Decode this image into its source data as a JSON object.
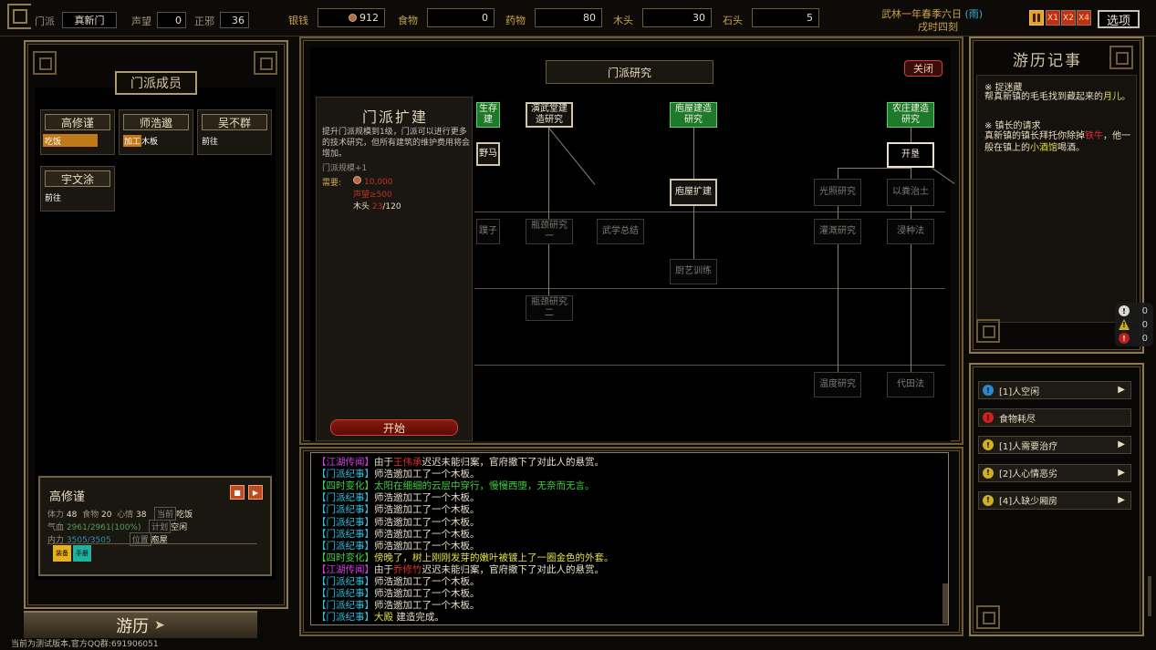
{
  "topbar": {
    "sect_label": "门派",
    "sect_name": "真新门",
    "reputation_label": "声望",
    "reputation": "0",
    "righteous_label": "正邪",
    "righteous": "36",
    "resources": [
      {
        "label": "银钱",
        "value": "912",
        "icon": "coin-icon"
      },
      {
        "label": "食物",
        "value": "0"
      },
      {
        "label": "药物",
        "value": "80"
      },
      {
        "label": "木头",
        "value": "30"
      },
      {
        "label": "石头",
        "value": "5"
      }
    ],
    "date": "武林一年春季六日",
    "weather": "(雨)",
    "time": "戌时四刻",
    "speeds": [
      "X1",
      "X2",
      "X4"
    ],
    "options_label": "选项"
  },
  "members": {
    "title": "门派成员",
    "list": [
      {
        "name": "高修谨",
        "action": "吃饭"
      },
      {
        "name": "师浩邈",
        "action_tag": "加工",
        "action": "木板"
      },
      {
        "name": "吴不群",
        "action": "前往"
      },
      {
        "name": "宇文涂",
        "action": "前往"
      }
    ]
  },
  "status": {
    "name": "高修谨",
    "stamina_label": "体力",
    "stamina": "48",
    "food_label": "食物",
    "food": "20",
    "mood_label": "心情",
    "mood": "38",
    "current_tag": "当前",
    "current": "吃饭",
    "qi_label": "气血",
    "qi": "2961/2961(100%)",
    "plan_tag": "计划",
    "plan": "空闲",
    "inner_label": "内力",
    "inner": "3505/3505",
    "pos_tag": "位置",
    "pos": "庖屋",
    "btn1": "装备",
    "btn2": "手册"
  },
  "travel_label": "游历",
  "research": {
    "title": "门派研究",
    "close_label": "关闭",
    "detail": {
      "name": "门派扩建",
      "desc": "提升门派规模到1级，门派可以进行更多的技术研究，但所有建筑的维护费用将会增加。",
      "effect": "门派规模+1",
      "need_label": "需要:",
      "need_money": "10,000",
      "need_rep": "声望≥500",
      "need_wood_label": "木头",
      "need_wood_have": "23",
      "need_wood_total": "/120"
    },
    "start_label": "开始",
    "nodes": {
      "survive": "生存\n建",
      "wild_horse": "野马",
      "dojo": "演武堂建\n造研究",
      "kitchen_build": "庖屋建造\n研究",
      "farm_build": "农庄建造\n研究",
      "cultivate": "开垦",
      "kitchen_expand": "庖屋扩建",
      "light": "光照研究",
      "manure": "以粪治土",
      "neck1": "瓶颈研究\n一",
      "martial": "武学总结",
      "ziza": "蹼子",
      "irrigate": "灌溉研究",
      "seed": "浸种法",
      "cook": "厨艺训练",
      "neck2": "瓶颈研究\n二",
      "temp": "温度研究",
      "field": "代田法"
    }
  },
  "log": [
    {
      "tag": "【江湖传闻】",
      "tag_color": "#d040e0",
      "parts": [
        {
          "t": "由于",
          "c": "#e8e0cc"
        },
        {
          "t": "王伟承",
          "c": "#e03030"
        },
        {
          "t": "迟迟未能归案，官府撤下了对此人的悬赏。",
          "c": "#e8e0cc"
        }
      ]
    },
    {
      "tag": "【门派纪事】",
      "tag_color": "#30c0e0",
      "parts": [
        {
          "t": "师浩邈加工了一个木板。",
          "c": "#e8e0cc"
        }
      ]
    },
    {
      "tag": "【四时变化】",
      "tag_color": "#40d040",
      "parts": [
        {
          "t": "太阳在细细的云层中穿行，慢慢西堕，无奈而无言。",
          "c": "#40d040"
        }
      ]
    },
    {
      "tag": "【门派纪事】",
      "tag_color": "#30c0e0",
      "parts": [
        {
          "t": "师浩邈加工了一个木板。",
          "c": "#e8e0cc"
        }
      ]
    },
    {
      "tag": "【门派纪事】",
      "tag_color": "#30c0e0",
      "parts": [
        {
          "t": "师浩邈加工了一个木板。",
          "c": "#e8e0cc"
        }
      ]
    },
    {
      "tag": "【门派纪事】",
      "tag_color": "#30c0e0",
      "parts": [
        {
          "t": "师浩邈加工了一个木板。",
          "c": "#e8e0cc"
        }
      ]
    },
    {
      "tag": "【门派纪事】",
      "tag_color": "#30c0e0",
      "parts": [
        {
          "t": "师浩邈加工了一个木板。",
          "c": "#e8e0cc"
        }
      ]
    },
    {
      "tag": "【门派纪事】",
      "tag_color": "#30c0e0",
      "parts": [
        {
          "t": "师浩邈加工了一个木板。",
          "c": "#e8e0cc"
        }
      ]
    },
    {
      "tag": "【四时变化】",
      "tag_color": "#40d040",
      "parts": [
        {
          "t": "傍晚了，树上刚刚发芽的嫩叶被镀上了一圈金色的外套。",
          "c": "#e8e040"
        }
      ]
    },
    {
      "tag": "【江湖传闻】",
      "tag_color": "#d040e0",
      "parts": [
        {
          "t": "由于",
          "c": "#e8e0cc"
        },
        {
          "t": "乔修竹",
          "c": "#e03030"
        },
        {
          "t": "迟迟未能归案，官府撤下了对此人的悬赏。",
          "c": "#e8e0cc"
        }
      ]
    },
    {
      "tag": "【门派纪事】",
      "tag_color": "#30c0e0",
      "parts": [
        {
          "t": "师浩邈加工了一个木板。",
          "c": "#e8e0cc"
        }
      ]
    },
    {
      "tag": "【门派纪事】",
      "tag_color": "#30c0e0",
      "parts": [
        {
          "t": "师浩邈加工了一个木板。",
          "c": "#e8e0cc"
        }
      ]
    },
    {
      "tag": "【门派纪事】",
      "tag_color": "#30c0e0",
      "parts": [
        {
          "t": "师浩邈加工了一个木板。",
          "c": "#e8e0cc"
        }
      ]
    },
    {
      "tag": "【门派纪事】",
      "tag_color": "#30c0e0",
      "parts": [
        {
          "t": "大殿",
          "c": "#e8e040"
        },
        {
          "t": " 建造完成。",
          "c": "#e8e0cc"
        }
      ]
    }
  ],
  "journal": {
    "title": "游历记事",
    "q1_title": "※ 捉迷藏",
    "q1_text_a": "帮真新镇的毛毛找到藏起来的",
    "q1_hl": "月儿",
    "q1_text_b": "。",
    "q2_title": "※ 镇长的请求",
    "q2_text_a": "真新镇的镇长拜托你除掉",
    "q2_hl1": "铁牛",
    "q2_text_b": "，他一般在镇上的",
    "q2_hl2": "小酒馆",
    "q2_text_c": "喝酒。"
  },
  "counters": {
    "white": "0",
    "yellow": "0",
    "red": "0"
  },
  "alerts": [
    {
      "label": "[1]人空闲",
      "icon": "info-icon",
      "color": "#2a8ad0",
      "arrow": true
    },
    {
      "label": "食物耗尽",
      "icon": "alert-icon",
      "color": "#d02020",
      "arrow": false
    },
    {
      "label": "[1]人需要治疗",
      "icon": "warning-icon",
      "color": "#d0b020",
      "arrow": true
    },
    {
      "label": "[2]人心情恶劣",
      "icon": "warning-icon",
      "color": "#d0b020",
      "arrow": true
    },
    {
      "label": "[4]人缺少厢房",
      "icon": "warning-icon",
      "color": "#d0b020",
      "arrow": true
    }
  ],
  "footer": "当前为测试版本,官方QQ群:691906051"
}
